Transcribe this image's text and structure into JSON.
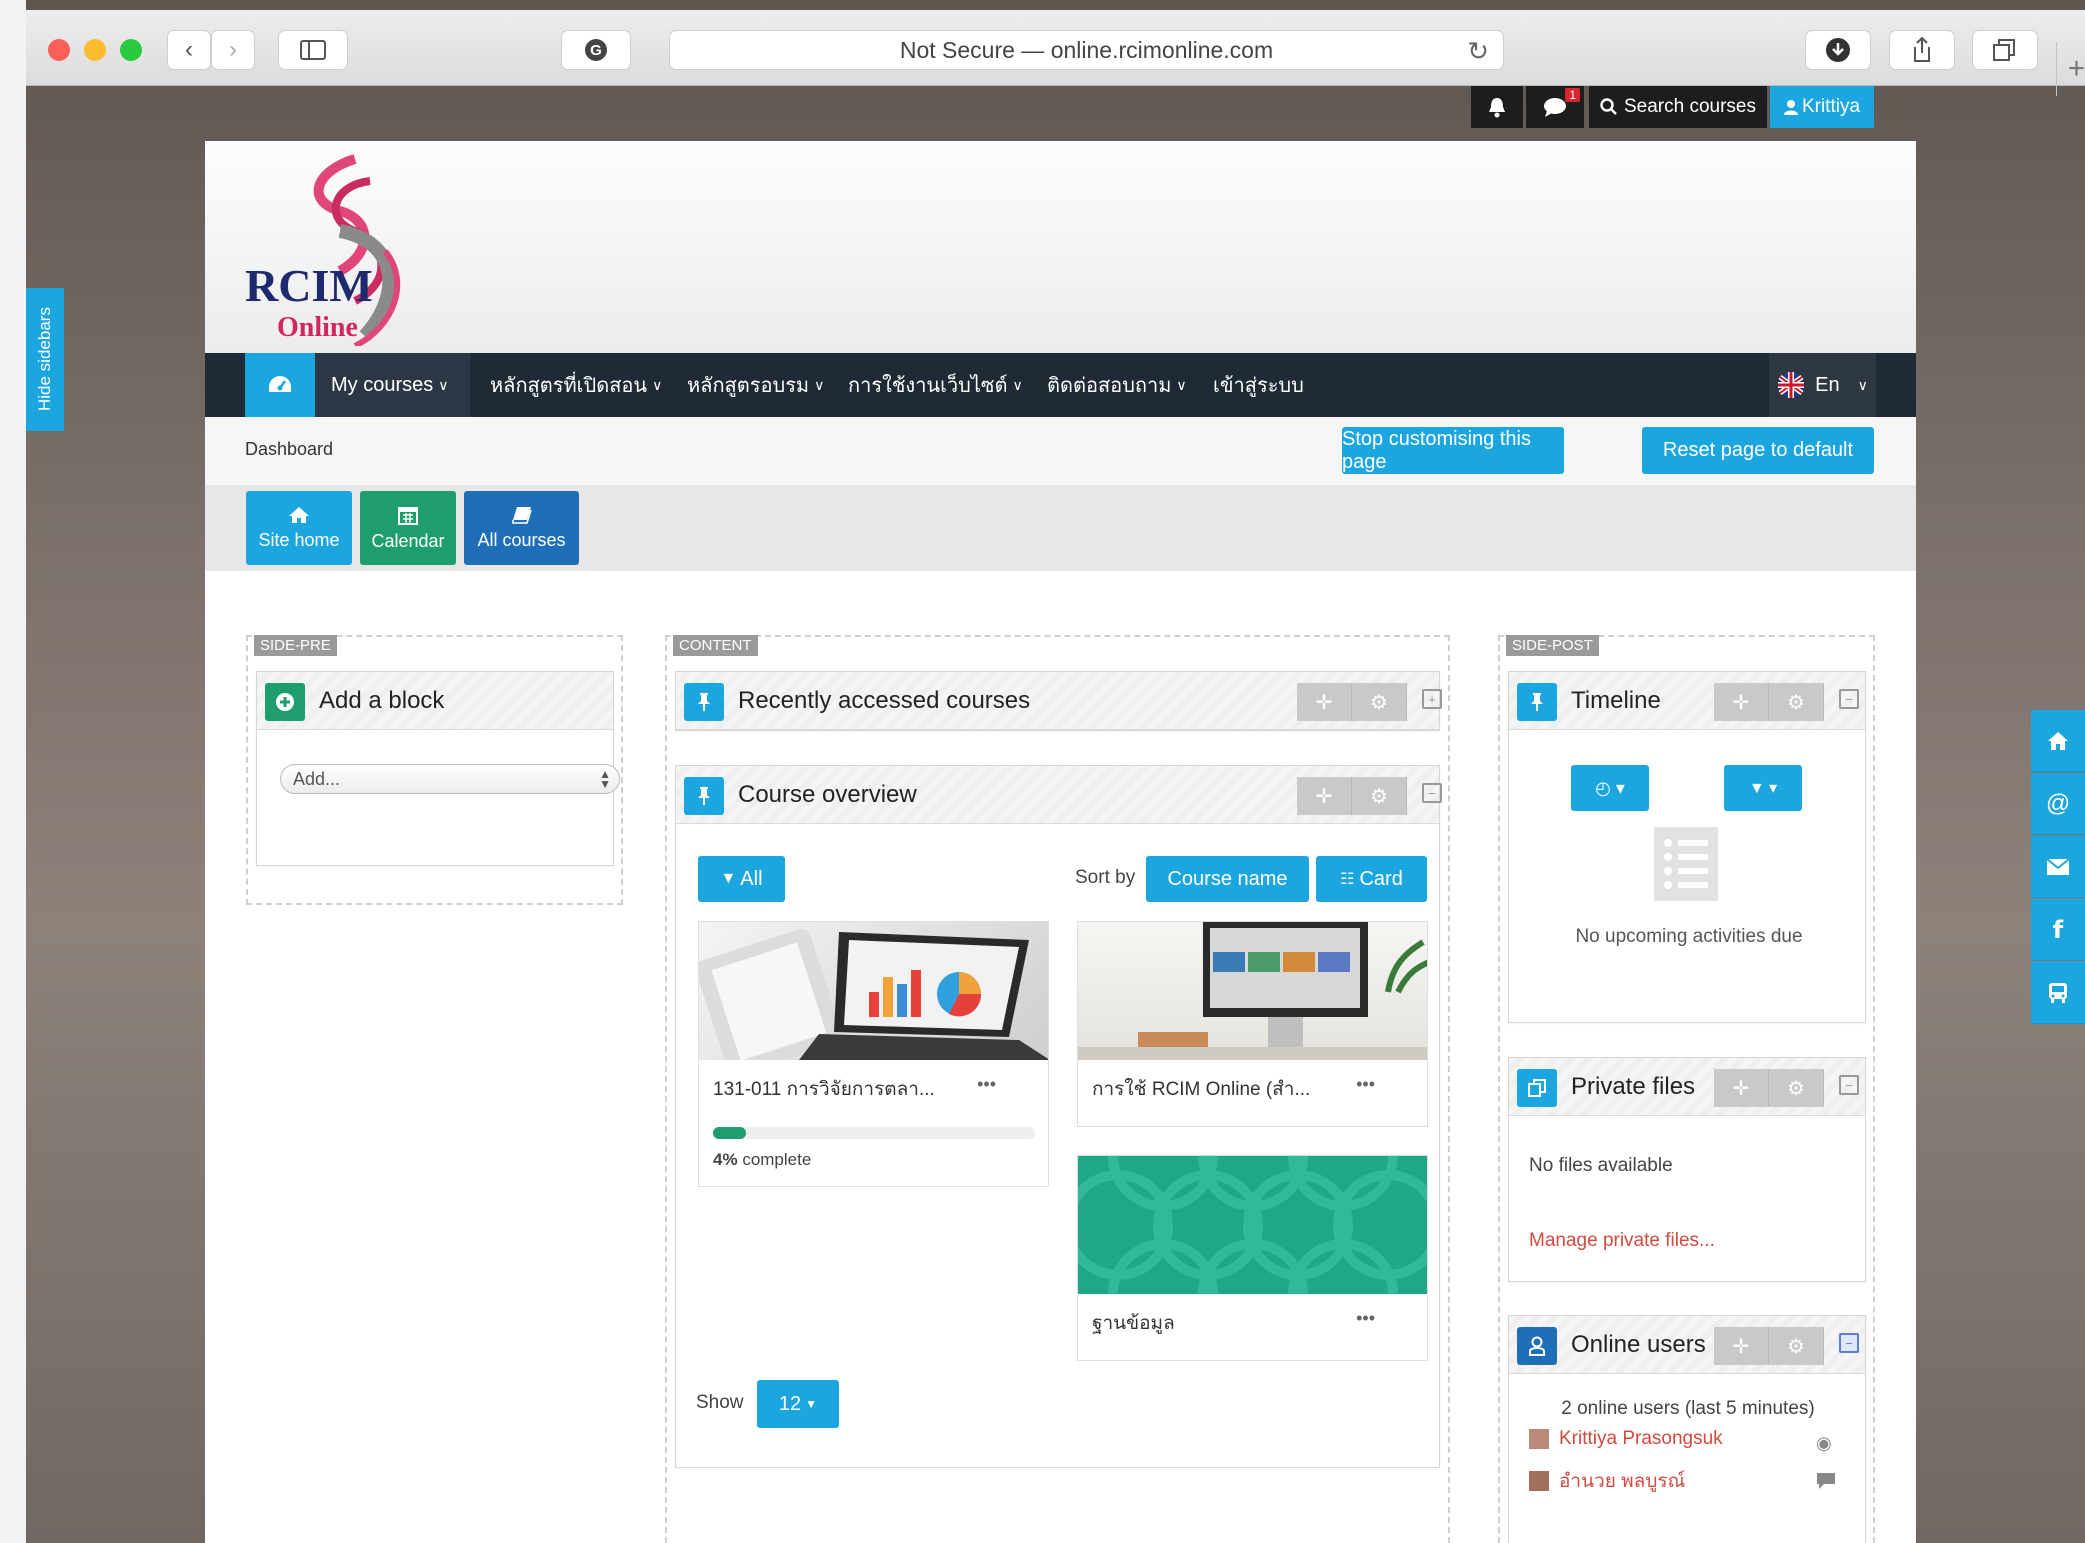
{
  "browser": {
    "url_text": "Not Secure — online.rcimonline.com",
    "new_tab": "+"
  },
  "userbar": {
    "notification_count": "1",
    "search_label": "Search courses",
    "user_label": "Krittiya"
  },
  "hide_sidebars": "Hide sidebars",
  "logo": {
    "line1": "RCIM",
    "line2": "Online"
  },
  "nav": {
    "items": [
      {
        "label": "My courses"
      },
      {
        "label": "หลักสูตรที่เปิดสอน"
      },
      {
        "label": "หลักสูตรอบรม"
      },
      {
        "label": "การใช้งานเว็บไซต์"
      },
      {
        "label": "ติดต่อสอบถาม"
      },
      {
        "label": "เข้าสู่ระบบ"
      }
    ],
    "language": "En"
  },
  "breadcrumb": "Dashboard",
  "actions": {
    "stop_customising": "Stop customising this page",
    "reset_default": "Reset page to default"
  },
  "quick": {
    "site_home": "Site home",
    "calendar": "Calendar",
    "all_courses": "All courses"
  },
  "regions": {
    "side_pre": "SIDE-PRE",
    "content": "CONTENT",
    "side_post": "SIDE-POST"
  },
  "add_block": {
    "title": "Add a block",
    "select_value": "Add..."
  },
  "recent": {
    "title": "Recently accessed courses"
  },
  "overview": {
    "title": "Course overview",
    "filter": "All",
    "sort_by": "Sort by",
    "sort_value": "Course name",
    "view": "Card",
    "show_label": "Show",
    "show_value": "12",
    "courses": [
      {
        "title": "131-011 การวิจัยการตลา...",
        "progress_pct": 4,
        "progress_value": "4%",
        "progress_suffix": "complete"
      },
      {
        "title": "การใช้ RCIM Online (สำ..."
      },
      {
        "title": "ฐานข้อมูล"
      }
    ]
  },
  "timeline": {
    "title": "Timeline",
    "empty": "No upcoming activities due"
  },
  "private_files": {
    "title": "Private files",
    "empty": "No files available",
    "manage": "Manage private files..."
  },
  "online_users": {
    "title": "Online users",
    "summary": "2 online users (last 5 minutes)",
    "users": [
      "Krittiya Prasongsuk",
      "อำนวย พลบูรณ์"
    ]
  },
  "colors": {
    "accent": "#1ca6e0",
    "green": "#1e9e6e",
    "navy": "#1e2a36",
    "link_red": "#d14b3e"
  }
}
